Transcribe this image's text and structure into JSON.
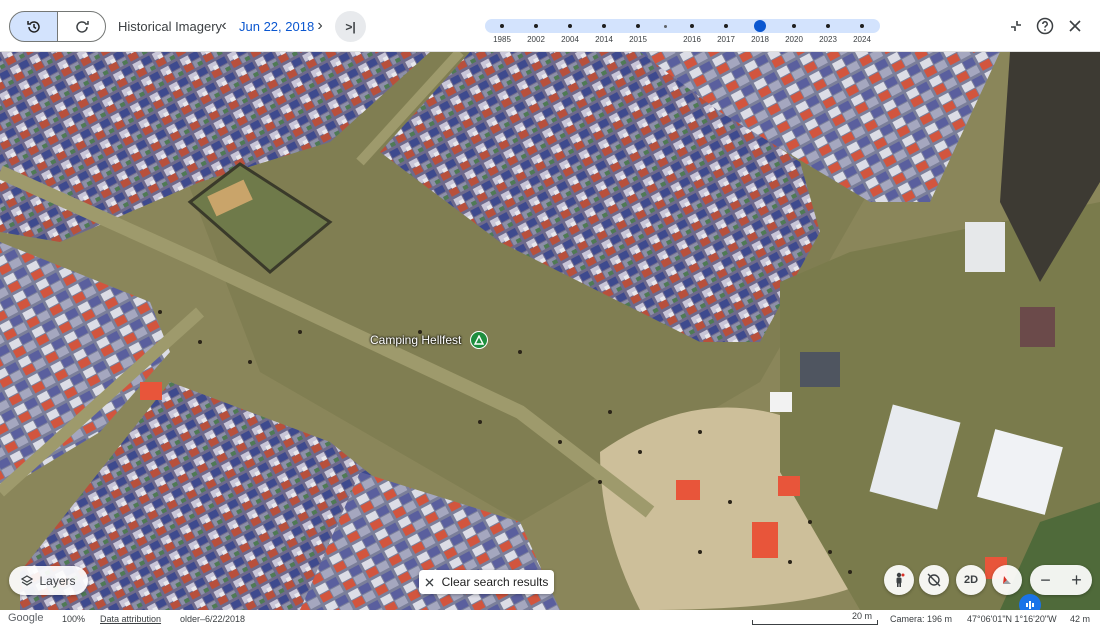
{
  "header": {
    "title": "Historical Imagery",
    "current_date": "Jun 22, 2018",
    "prev_label": "‹",
    "next_label": "›",
    "latest_label": ">|"
  },
  "timeline": {
    "years": [
      "1985",
      "2002",
      "2004",
      "2014",
      "2015",
      "2016",
      "2017",
      "2018",
      "2020",
      "2023",
      "2024"
    ],
    "selected_year": "2018"
  },
  "map": {
    "place_label": "Camping Hellfest"
  },
  "controls": {
    "layers_label": "Layers",
    "clear_label": "Clear search results",
    "view_2d_label": "2D",
    "zoom_out": "−",
    "zoom_in": "+"
  },
  "status": {
    "brand": "Google",
    "zoom_percent": "100%",
    "attribution": "Data attribution",
    "imagery_date": "older–6/22/2018",
    "scale": "20 m",
    "camera": "Camera: 196 m",
    "coordinates": "47°06'01\"N 1°16'20\"W",
    "altitude": "42 m"
  },
  "colors": {
    "accent": "#0b57d0",
    "timeline_bg": "#d3e3fd",
    "pin": "#1e8e3e"
  }
}
